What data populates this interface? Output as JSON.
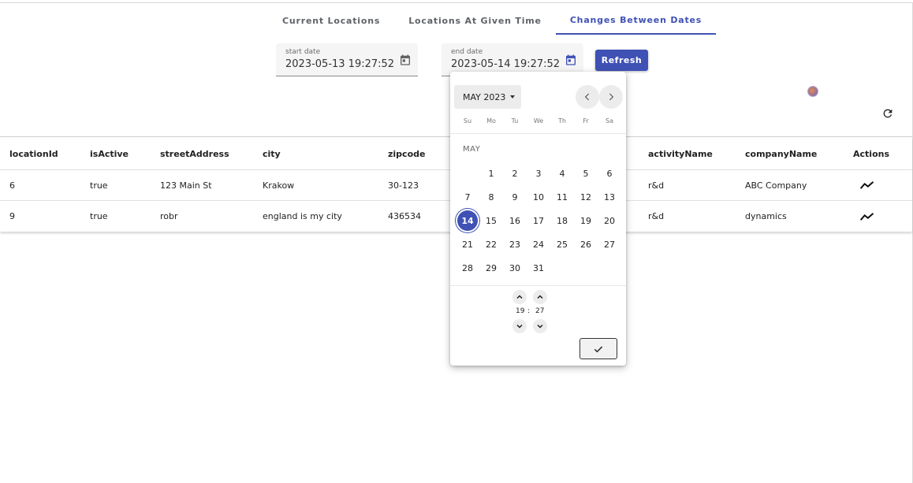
{
  "tabs": [
    {
      "label": "Current Locations"
    },
    {
      "label": "Locations At Given Time"
    },
    {
      "label": "Changes Between Dates"
    }
  ],
  "start_date": {
    "label": "start date",
    "value": "2023-05-13 19:27:52"
  },
  "end_date": {
    "label": "end date",
    "value": "2023-05-14 19:27:52"
  },
  "refresh_label": "Refresh",
  "colors": {
    "accent": "#3f51b5"
  },
  "table": {
    "columns": [
      "locationId",
      "isActive",
      "streetAddress",
      "city",
      "zipcode",
      "activityName",
      "companyName",
      "Actions"
    ],
    "rows": [
      {
        "locationId": "6",
        "isActive": "true",
        "streetAddress": "123 Main St",
        "city": "Krakow",
        "zipcode": "30-123",
        "activityName": "r&d",
        "companyName": "ABC Company",
        "action_icon": "trending-icon"
      },
      {
        "locationId": "9",
        "isActive": "true",
        "streetAddress": "robr",
        "city": "england is my city",
        "zipcode": "436534",
        "activityName": "r&d",
        "companyName": "dynamics",
        "action_icon": "trending-icon"
      }
    ]
  },
  "picker": {
    "month_button": "MAY 2023",
    "weekdays": [
      "Su",
      "Mo",
      "Tu",
      "We",
      "Th",
      "Fr",
      "Sa"
    ],
    "month_label": "MAY",
    "days": [
      "1",
      "2",
      "3",
      "4",
      "5",
      "6",
      "7",
      "8",
      "9",
      "10",
      "11",
      "12",
      "13",
      "14",
      "15",
      "16",
      "17",
      "18",
      "19",
      "20",
      "21",
      "22",
      "23",
      "24",
      "25",
      "26",
      "27",
      "28",
      "29",
      "30",
      "31"
    ],
    "selected_day": "14",
    "hour": "19",
    "minute": "27",
    "time_separator": ":"
  }
}
